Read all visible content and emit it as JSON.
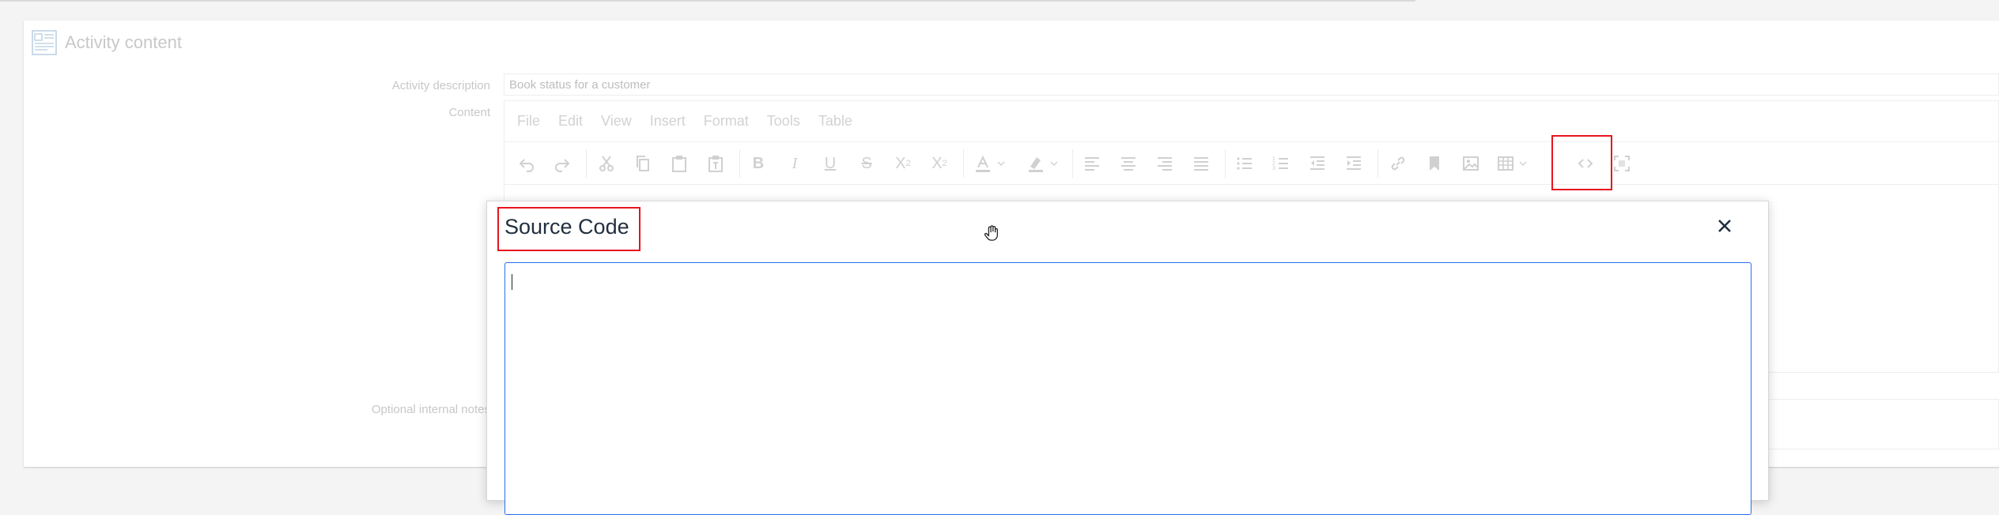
{
  "panel": {
    "title": "Activity content",
    "icon": "content-panel-icon"
  },
  "form": {
    "activity_description_label": "Activity description",
    "activity_description_value": "Book status for a customer",
    "content_label": "Content",
    "optional_notes_label": "Optional internal notes"
  },
  "editor": {
    "menu": [
      "File",
      "Edit",
      "View",
      "Insert",
      "Format",
      "Tools",
      "Table"
    ],
    "toolbar_icons": [
      "undo-icon",
      "redo-icon",
      "cut-icon",
      "copy-icon",
      "paste-icon",
      "paste-text-icon",
      "bold-icon",
      "italic-icon",
      "underline-icon",
      "strikethrough-icon",
      "subscript-icon",
      "superscript-icon",
      "text-color-icon",
      "highlight-color-icon",
      "align-left-icon",
      "align-center-icon",
      "align-right-icon",
      "align-justify-icon",
      "bullet-list-icon",
      "numbered-list-icon",
      "outdent-icon",
      "indent-icon",
      "link-icon",
      "bookmark-icon",
      "image-icon",
      "table-icon",
      "source-code-icon",
      "fullscreen-icon"
    ]
  },
  "dialog": {
    "title": "Source Code",
    "close_icon": "close-icon",
    "textarea_value": ""
  },
  "colors": {
    "highlight": "#e8141e",
    "focus_border": "#2672ec",
    "dialog_title": "#222f3e"
  }
}
